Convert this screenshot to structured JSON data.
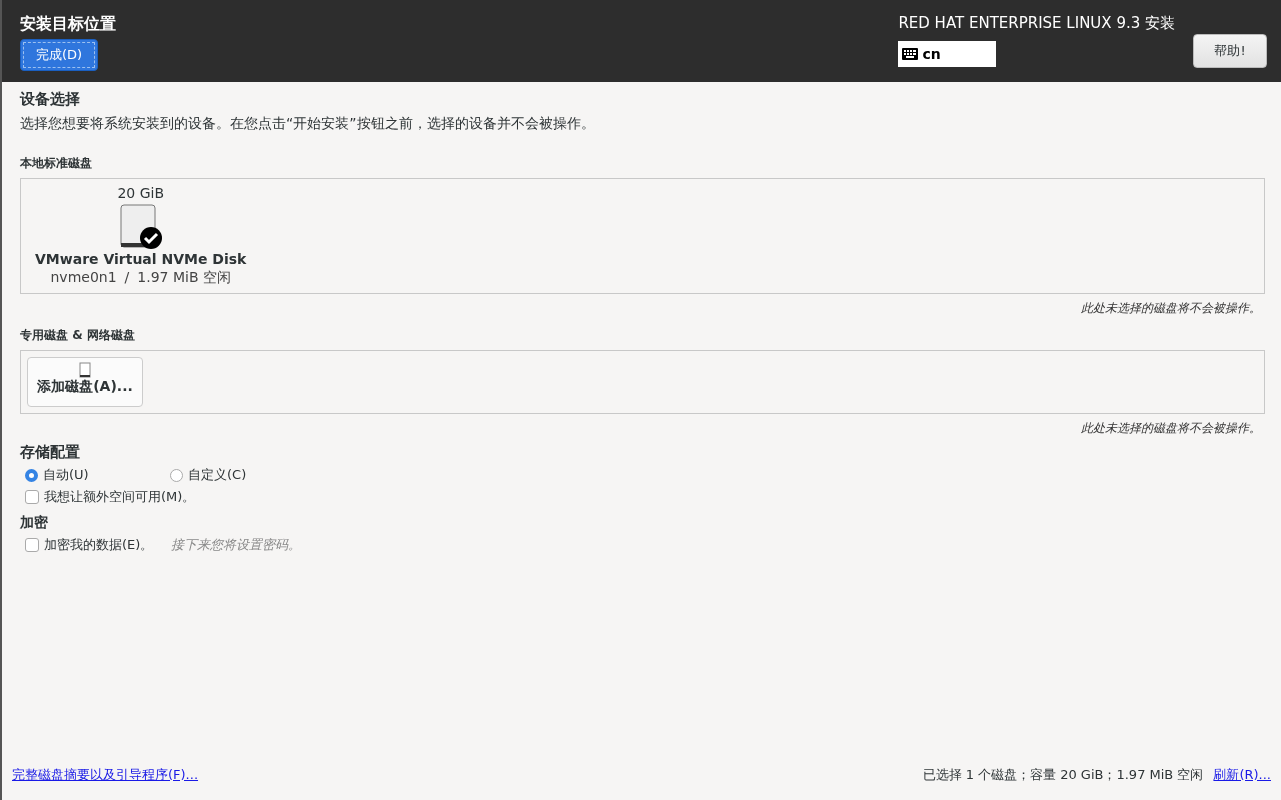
{
  "header": {
    "title": "安装目标位置",
    "done_button": "完成(D)",
    "product": "RED HAT ENTERPRISE LINUX 9.3 安装",
    "keyboard_layout": "cn",
    "help_button": "帮助!"
  },
  "device_selection": {
    "heading": "设备选择",
    "description": "选择您想要将系统安装到的设备。在您点击“开始安装”按钮之前，选择的设备并不会被操作。"
  },
  "local_disks": {
    "heading": "本地标准磁盘",
    "disks": [
      {
        "size": "20 GiB",
        "name": "VMware Virtual NVMe Disk",
        "device": "nvme0n1",
        "separator": "/",
        "free": "1.97 MiB 空闲",
        "selected": true
      }
    ],
    "note": "此处未选择的磁盘将不会被操作。"
  },
  "special_disks": {
    "heading": "专用磁盘 & 网络磁盘",
    "add_button": "添加磁盘(A)...",
    "note": "此处未选择的磁盘将不会被操作。"
  },
  "storage": {
    "heading": "存储配置",
    "options": [
      {
        "label": "自动(U)",
        "selected": true
      },
      {
        "label": "自定义(C)",
        "selected": false
      }
    ],
    "extra_space": {
      "label": "我想让额外空间可用(M)。",
      "checked": false
    }
  },
  "encryption": {
    "heading": "加密",
    "checkbox": {
      "label": "加密我的数据(E)。",
      "checked": false
    },
    "hint": "接下来您将设置密码。"
  },
  "footer": {
    "summary_link": "完整磁盘摘要以及引导程序(F)...",
    "status": "已选择 1 个磁盘；容量 20 GiB；1.97 MiB 空闲",
    "refresh_link": "刷新(R)..."
  }
}
